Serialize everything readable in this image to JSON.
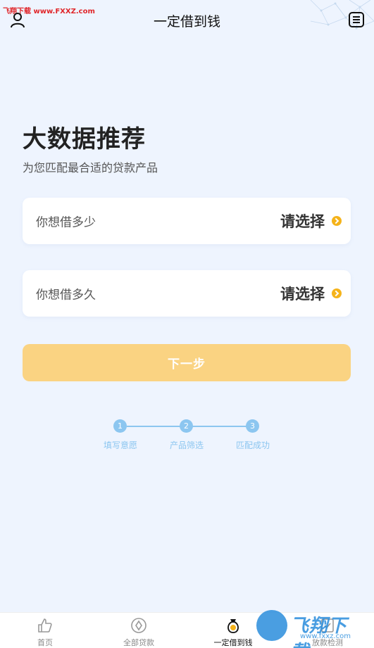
{
  "watermark_top": "飞翔下载 www.FXXZ.com",
  "header": {
    "title": "一定借到钱",
    "user_icon": "user-icon",
    "menu_icon": "menu-list-icon"
  },
  "hero": {
    "title": "大数据推荐",
    "subtitle": "为您匹配最合适的贷款产品"
  },
  "cards": [
    {
      "question": "你想借多少",
      "select_label": "请选择"
    },
    {
      "question": "你想借多久",
      "select_label": "请选择"
    }
  ],
  "next_button": {
    "label": "下一步",
    "color": "#fad382"
  },
  "steps": [
    {
      "number": "1",
      "label": "填写意愿"
    },
    {
      "number": "2",
      "label": "产品筛选"
    },
    {
      "number": "3",
      "label": "匹配成功"
    }
  ],
  "tabbar": [
    {
      "label": "首页",
      "icon": "thumbs-up-icon"
    },
    {
      "label": "全部贷款",
      "icon": "compass-icon"
    },
    {
      "label": "一定借到钱",
      "icon": "money-bag-icon",
      "active": true
    },
    {
      "label": "放款检测",
      "icon": "check-icon"
    }
  ],
  "watermark_bottom": {
    "text": "飞翔下载",
    "url": "www.fxxz.com"
  },
  "colors": {
    "accent": "#f5b31a",
    "step": "#8cc6f0",
    "background": "#eef4fe"
  }
}
